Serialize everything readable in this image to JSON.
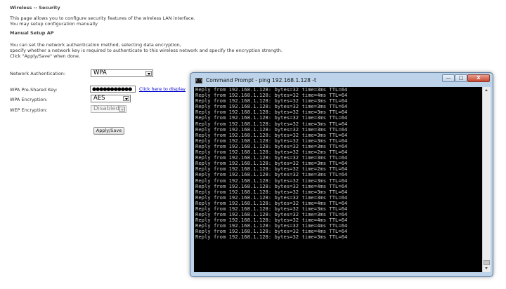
{
  "page": {
    "heading": "Wireless -- Security",
    "desc1": "This page allows you to configure security features of the wireless LAN interface.",
    "desc2": "You may setup configuration manually",
    "section_title": "Manual Setup AP",
    "info1": "You can set the network authentication method, selecting data encryption,",
    "info2": "specify whether a network key is required to authenticate to this wireless network and specify the encryption strength.",
    "info3": "Click \"Apply/Save\" when done."
  },
  "form": {
    "auth_label": "Network Authentication:",
    "auth_value": "WPA",
    "psk_label": "WPA Pre-Shared Key:",
    "psk_value": "●●●●●●●●●●●",
    "display_link": "Click here to display",
    "enc_label": "WPA Encryption:",
    "enc_value": "AES",
    "wep_label": "WEP Encryption:",
    "wep_value": "Disabled",
    "apply_label": "Apply/Save"
  },
  "cmd": {
    "title": "Command Prompt - ping  192.168.1.128 -t",
    "btn_minimize": "—",
    "btn_maximize": "□",
    "btn_close": "X",
    "lines": [
      "Reply from 192.168.1.128: bytes=32 time=3ms TTL=64",
      "Reply from 192.168.1.128: bytes=32 time=4ms TTL=64",
      "Reply from 192.168.1.128: bytes=32 time=3ms TTL=64",
      "Reply from 192.168.1.128: bytes=32 time=3ms TTL=64",
      "Reply from 192.168.1.128: bytes=32 time=3ms TTL=64",
      "Reply from 192.168.1.128: bytes=32 time=3ms TTL=64",
      "Reply from 192.168.1.128: bytes=32 time=3ms TTL=64",
      "Reply from 192.168.1.128: bytes=32 time=3ms TTL=64",
      "Reply from 192.168.1.128: bytes=32 time=3ms TTL=64",
      "Reply from 192.168.1.128: bytes=32 time=3ms TTL=64",
      "Reply from 192.168.1.128: bytes=32 time=3ms TTL=64",
      "Reply from 192.168.1.128: bytes=32 time=2ms TTL=64",
      "Reply from 192.168.1.128: bytes=32 time=3ms TTL=64",
      "Reply from 192.168.1.128: bytes=32 time=3ms TTL=64",
      "Reply from 192.168.1.128: bytes=32 time=2ms TTL=64",
      "Reply from 192.168.1.128: bytes=32 time=3ms TTL=64",
      "Reply from 192.168.1.128: bytes=32 time=3ms TTL=64",
      "Reply from 192.168.1.128: bytes=32 time=4ms TTL=64",
      "Reply from 192.168.1.128: bytes=32 time=3ms TTL=64",
      "Reply from 192.168.1.128: bytes=32 time=3ms TTL=64",
      "Reply from 192.168.1.128: bytes=32 time=4ms TTL=64",
      "Reply from 192.168.1.128: bytes=32 time=3ms TTL=64",
      "Reply from 192.168.1.128: bytes=32 time=3ms TTL=64",
      "Reply from 192.168.1.128: bytes=32 time=4ms TTL=64",
      "Reply from 192.168.1.128: bytes=32 time=4ms TTL=64",
      "Reply from 192.168.1.128: bytes=32 time=4ms TTL=64",
      "Reply from 192.168.1.128: bytes=32 time=3ms TTL=64"
    ]
  }
}
